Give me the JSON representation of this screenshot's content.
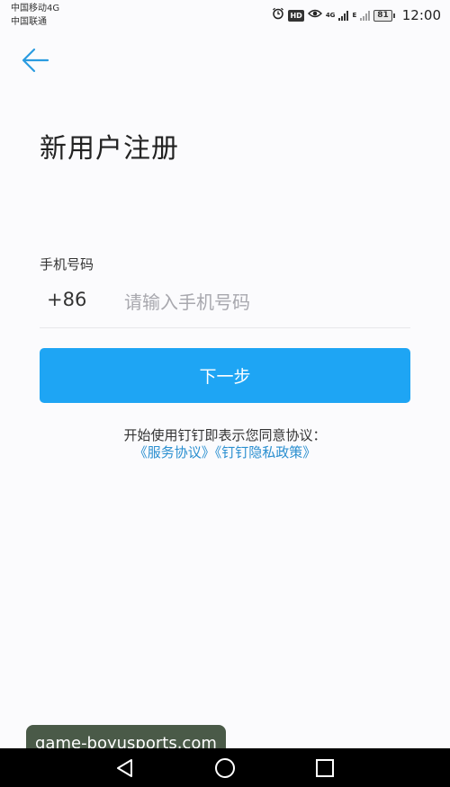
{
  "status_bar": {
    "carrier_line1": "中国移动4G",
    "carrier_line2": "中国联通",
    "hd_badge": "HD",
    "net_4g": "4G",
    "net_e": "E",
    "battery_level": "81",
    "time": "12:00",
    "icons": [
      "alarm-icon",
      "eye-icon",
      "signal-icon",
      "battery-icon"
    ]
  },
  "header": {
    "back_icon": "back-arrow-icon",
    "title": "新用户注册"
  },
  "form": {
    "phone_label": "手机号码",
    "country_code": "+86",
    "phone_placeholder": "请输入手机号码",
    "phone_value": "",
    "next_button_label": "下一步"
  },
  "agreement": {
    "text": "开始使用钉钉即表示您同意协议：",
    "service_link": "《服务协议》",
    "privacy_link": "《钉钉隐私政策》"
  },
  "watermark": {
    "text": "game-boyusports.com"
  },
  "nav_bar": {
    "icons": [
      "back-triangle-icon",
      "home-circle-icon",
      "recents-square-icon"
    ]
  },
  "colors": {
    "accent": "#1ea5f4",
    "link": "#2a8fd0",
    "background": "#fbfbfd"
  }
}
